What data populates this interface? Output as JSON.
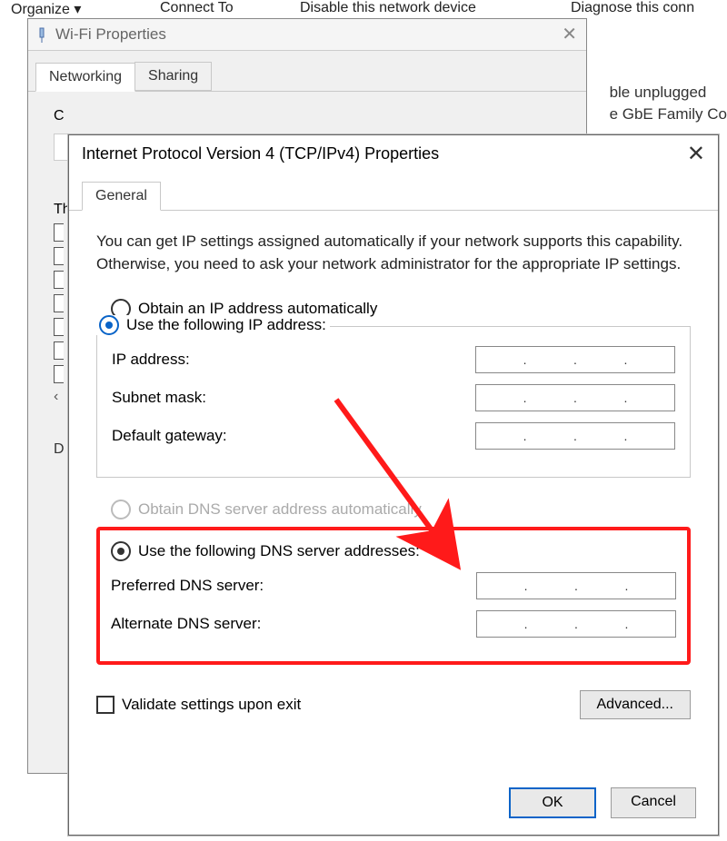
{
  "topmenu": {
    "organize": "Organize ▾",
    "connect": "Connect To",
    "disable": "Disable this network device",
    "diagnose": "Diagnose this conn"
  },
  "bgRight": {
    "line1": "ble unplugged",
    "line2": "e GbE Family Co"
  },
  "wifi": {
    "title": "Wi-Fi Properties",
    "tabs": {
      "networking": "Networking",
      "sharing": "Sharing"
    },
    "connectLabelPrefix": "C",
    "thPrefix": "Th",
    "d": "D",
    "chev": "‹"
  },
  "ipv4": {
    "title": "Internet Protocol Version 4 (TCP/IPv4) Properties",
    "tab": "General",
    "desc": "You can get IP settings assigned automatically if your network supports this capability. Otherwise, you need to ask your network administrator for the appropriate IP settings.",
    "obtainIpAuto": "Obtain an IP address automatically",
    "useIp": "Use the following IP address:",
    "ipAddress": "IP address:",
    "subnet": "Subnet mask:",
    "gateway": "Default gateway:",
    "obtainDnsAuto": "Obtain DNS server address automatically",
    "useDns": "Use the following DNS server addresses:",
    "prefDns": "Preferred DNS server:",
    "altDns": "Alternate DNS server:",
    "validate": "Validate settings upon exit",
    "advanced": "Advanced...",
    "ok": "OK",
    "cancel": "Cancel",
    "dotSep": "."
  }
}
